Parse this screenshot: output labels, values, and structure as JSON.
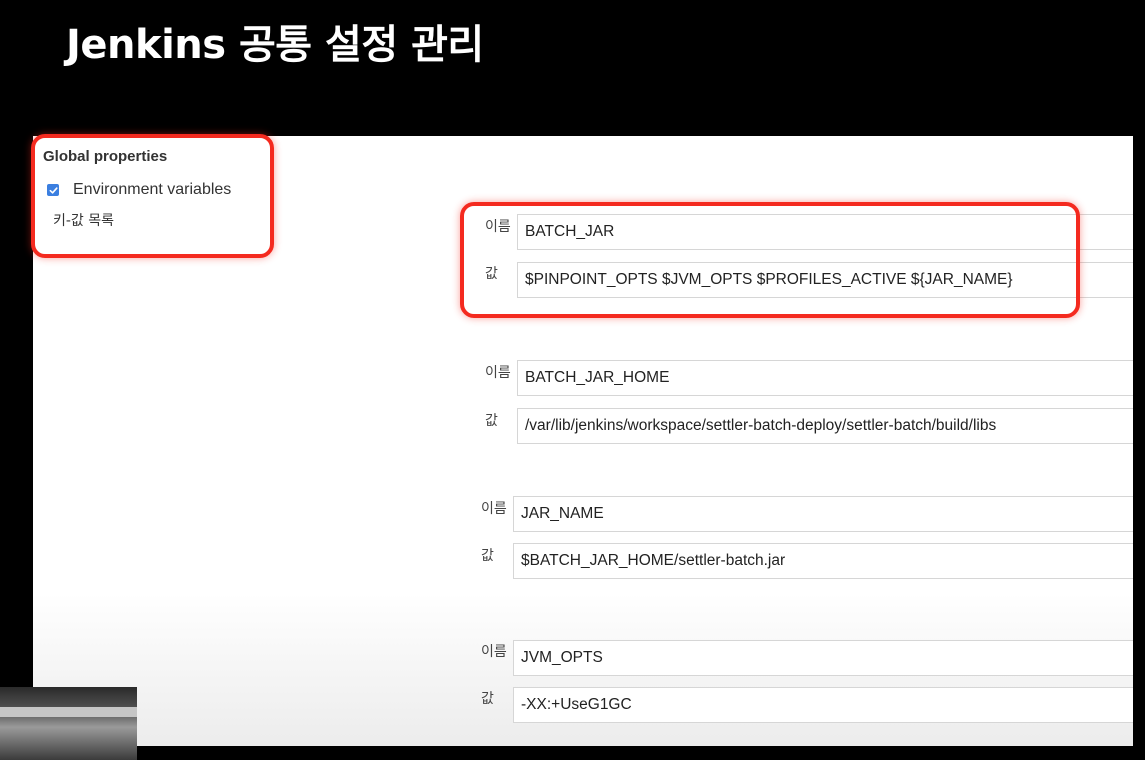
{
  "slide": {
    "title": "Jenkins 공통 설정 관리"
  },
  "global_properties": {
    "title": "Global properties",
    "env_checked": true,
    "env_label": "Environment variables",
    "kv_list_label": "키-값 목록"
  },
  "env_vars": [
    {
      "name_label": "이름",
      "name": "BATCH_JAR",
      "value_label": "값",
      "value": "$PINPOINT_OPTS $JVM_OPTS $PROFILES_ACTIVE ${JAR_NAME}"
    },
    {
      "name_label": "이름",
      "name": "BATCH_JAR_HOME",
      "value_label": "값",
      "value": "/var/lib/jenkins/workspace/settler-batch-deploy/settler-batch/build/libs"
    },
    {
      "name_label": "이름",
      "name": "JAR_NAME",
      "value_label": "값",
      "value": "$BATCH_JAR_HOME/settler-batch.jar"
    },
    {
      "name_label": "이름",
      "name": "JVM_OPTS",
      "value_label": "값",
      "value": "-XX:+UseG1GC"
    }
  ],
  "colors": {
    "highlight": "#f42a1f",
    "checkbox": "#3b7fe0"
  }
}
